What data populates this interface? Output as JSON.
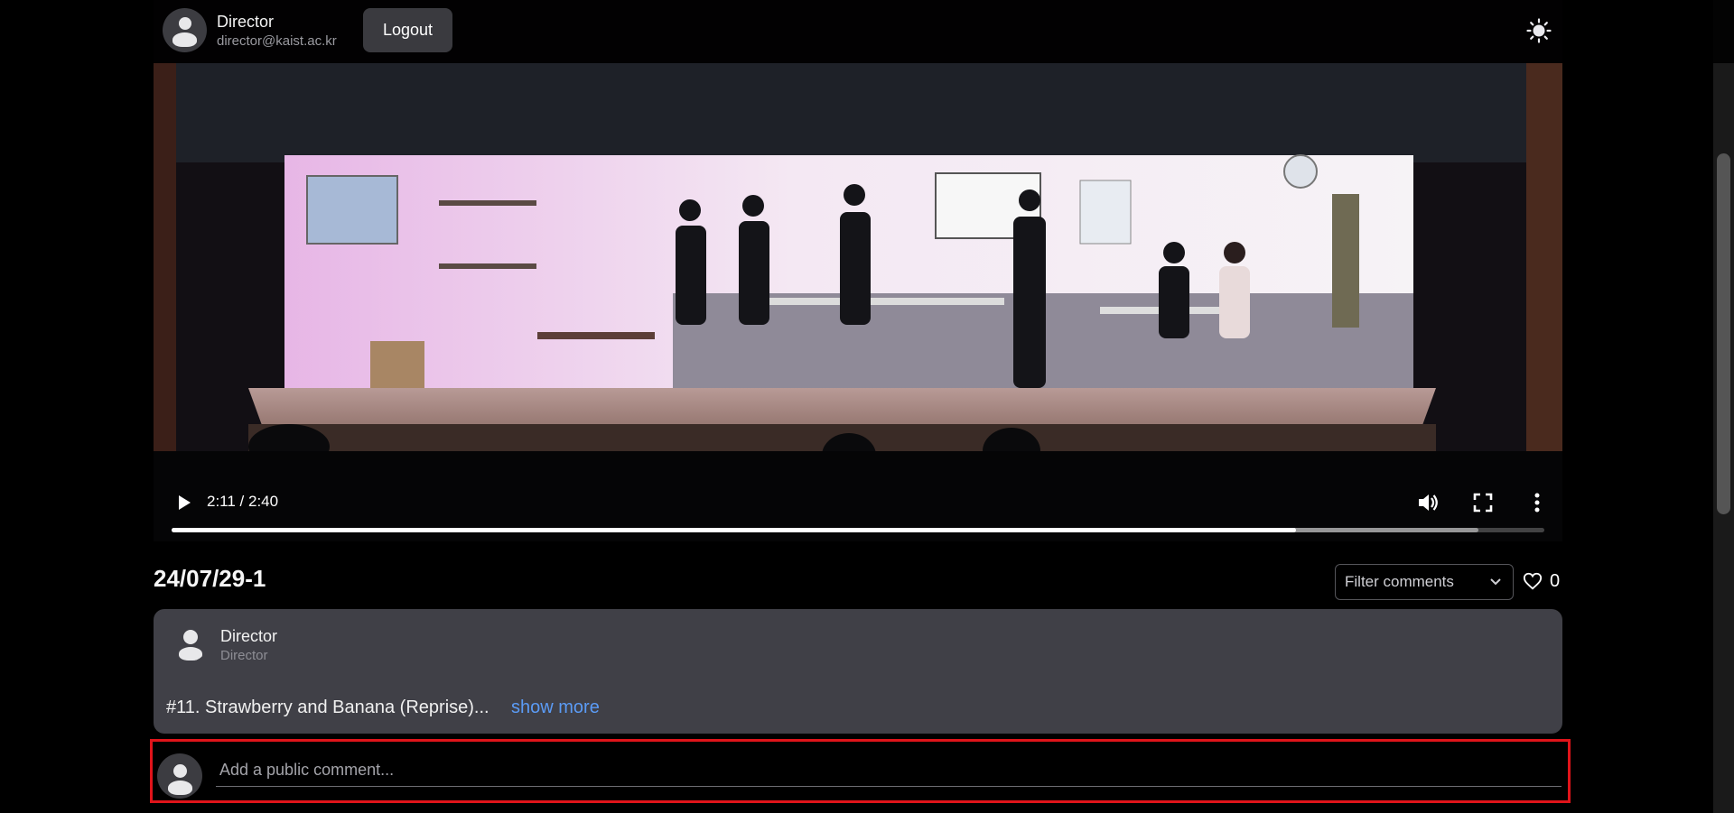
{
  "header": {
    "user_name": "Director",
    "user_email": "director@kaist.ac.kr",
    "logout_label": "Logout",
    "theme_icon": "sun-icon"
  },
  "video": {
    "time_display": "2:11 / 2:40",
    "progress_fraction": 0.819,
    "buffered_fraction": 0.952,
    "controls": [
      "play-icon",
      "volume-icon",
      "fullscreen-icon",
      "more-vertical-icon"
    ]
  },
  "main": {
    "title": "24/07/29-1",
    "filter_placeholder": "Filter comments",
    "like_count": "0"
  },
  "comments": [
    {
      "author": "Director",
      "role": "Director",
      "text": "#11. Strawberry and Banana (Reprise)...",
      "show_more_label": "show more"
    }
  ],
  "add_comment": {
    "placeholder": "Add a public comment..."
  },
  "colors": {
    "accent_link": "#5b9bf5",
    "highlight_border": "#e0141a",
    "card_bg": "#404047"
  }
}
